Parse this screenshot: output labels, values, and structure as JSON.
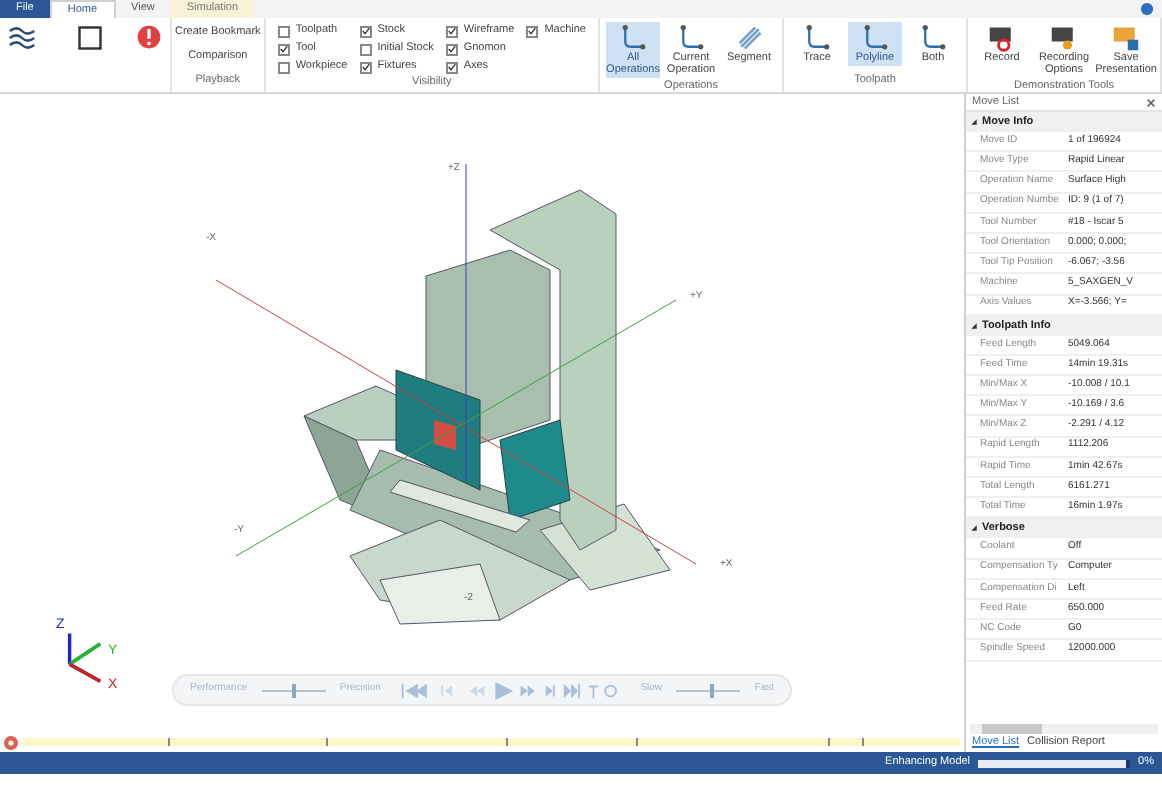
{
  "menu_tabs": [
    {
      "label": "File",
      "selected": false,
      "kind": "file"
    },
    {
      "label": "Home",
      "selected": true,
      "kind": "tab"
    },
    {
      "label": "View",
      "selected": false,
      "kind": "tab"
    },
    {
      "label": "Simulation",
      "selected": false,
      "kind": "context"
    }
  ],
  "playback_group": {
    "create_bookmark": "Create Bookmark",
    "comparison": "Comparison",
    "label": "Playback"
  },
  "visibility": {
    "label": "Visibility",
    "options": [
      {
        "label": "Toolpath",
        "checked": false
      },
      {
        "label": "Tool",
        "checked": true
      },
      {
        "label": "Workpiece",
        "checked": false
      },
      {
        "label": "Stock",
        "checked": true
      },
      {
        "label": "Initial Stock",
        "checked": false
      },
      {
        "label": "Fixtures",
        "checked": true
      },
      {
        "label": "Wireframe",
        "checked": true
      },
      {
        "label": "Gnomon",
        "checked": true
      },
      {
        "label": "Axes",
        "checked": true
      },
      {
        "label": "Machine",
        "checked": true
      }
    ]
  },
  "operations": {
    "label": "Operations",
    "buttons": [
      {
        "label": "All Operations",
        "selected": true
      },
      {
        "label": "Current Operation",
        "selected": false
      },
      {
        "label": "Segment",
        "selected": false
      }
    ]
  },
  "toolpath": {
    "label": "Toolpath",
    "buttons": [
      {
        "label": "Trace",
        "selected": false
      },
      {
        "label": "Polyline",
        "selected": true
      },
      {
        "label": "Both",
        "selected": false
      }
    ]
  },
  "demonstration_tools": {
    "label": "Demonstration Tools",
    "buttons": [
      {
        "label": "Record",
        "kind": "record"
      },
      {
        "label": "Recording Options",
        "kind": "options"
      },
      {
        "label": "Save Presentation",
        "kind": "save"
      }
    ]
  },
  "viewport": {
    "axis_labels": [
      "+Z",
      "-X",
      "+Y",
      "-Y",
      "+X",
      "-2"
    ],
    "gnomon": [
      "Z",
      "Y",
      "X"
    ],
    "playback": {
      "performance": "Performance",
      "precision": "Precision",
      "quality_slider": {
        "level": 0.5
      },
      "slow": "Slow",
      "fast": "Fast",
      "speed_slider": {
        "level": 0.55
      }
    }
  },
  "move_list": {
    "title": "Move List",
    "sections": [
      {
        "title": "Move Info",
        "expanded": true,
        "rows": [
          [
            "Move ID",
            "1 of 196924"
          ],
          [
            "Move Type",
            "Rapid Linear"
          ],
          [
            "Operation Name",
            "Surface High"
          ],
          [
            "Operation Numbe",
            "ID: 9 (1 of 7)"
          ],
          [
            "Tool Number",
            "#18 - Iscar 5"
          ],
          [
            "Tool Orientation",
            "0.000; 0.000;"
          ],
          [
            "Tool Tip Position",
            "-6.067; -3.56"
          ],
          [
            "Machine",
            "5_SAXGEN_V"
          ],
          [
            "Axis Values",
            "X=-3.566; Y="
          ]
        ]
      },
      {
        "title": "Toolpath Info",
        "expanded": true,
        "rows": [
          [
            "Feed Length",
            "5049.064"
          ],
          [
            "Feed Time",
            "14min 19.31s"
          ],
          [
            "Min/Max X",
            "-10.008 / 10.1"
          ],
          [
            "Min/Max Y",
            "-10.169 / 3.6"
          ],
          [
            "Min/Max Z",
            "-2.291 / 4.12"
          ],
          [
            "Rapid Length",
            "1112.206"
          ],
          [
            "Rapid Time",
            "1min 42.67s"
          ],
          [
            "Total Length",
            "6161.271"
          ],
          [
            "Total Time",
            "16min 1.97s"
          ]
        ]
      },
      {
        "title": "Verbose",
        "expanded": true,
        "rows": [
          [
            "Coolant",
            "Off"
          ],
          [
            "Compensation Ty",
            "Computer"
          ],
          [
            "Compensation Di",
            "Left"
          ],
          [
            "Feed Rate",
            "650.000"
          ],
          [
            "NC Code",
            "G0"
          ],
          [
            "Spindle Speed",
            "12000.000"
          ]
        ]
      }
    ],
    "tabs": [
      {
        "label": "Move List",
        "selected": true
      },
      {
        "label": "Collision Report",
        "selected": false
      }
    ]
  },
  "status_bar": {
    "text": "Enhancing Model",
    "level": 0.97,
    "percent": "0%"
  }
}
